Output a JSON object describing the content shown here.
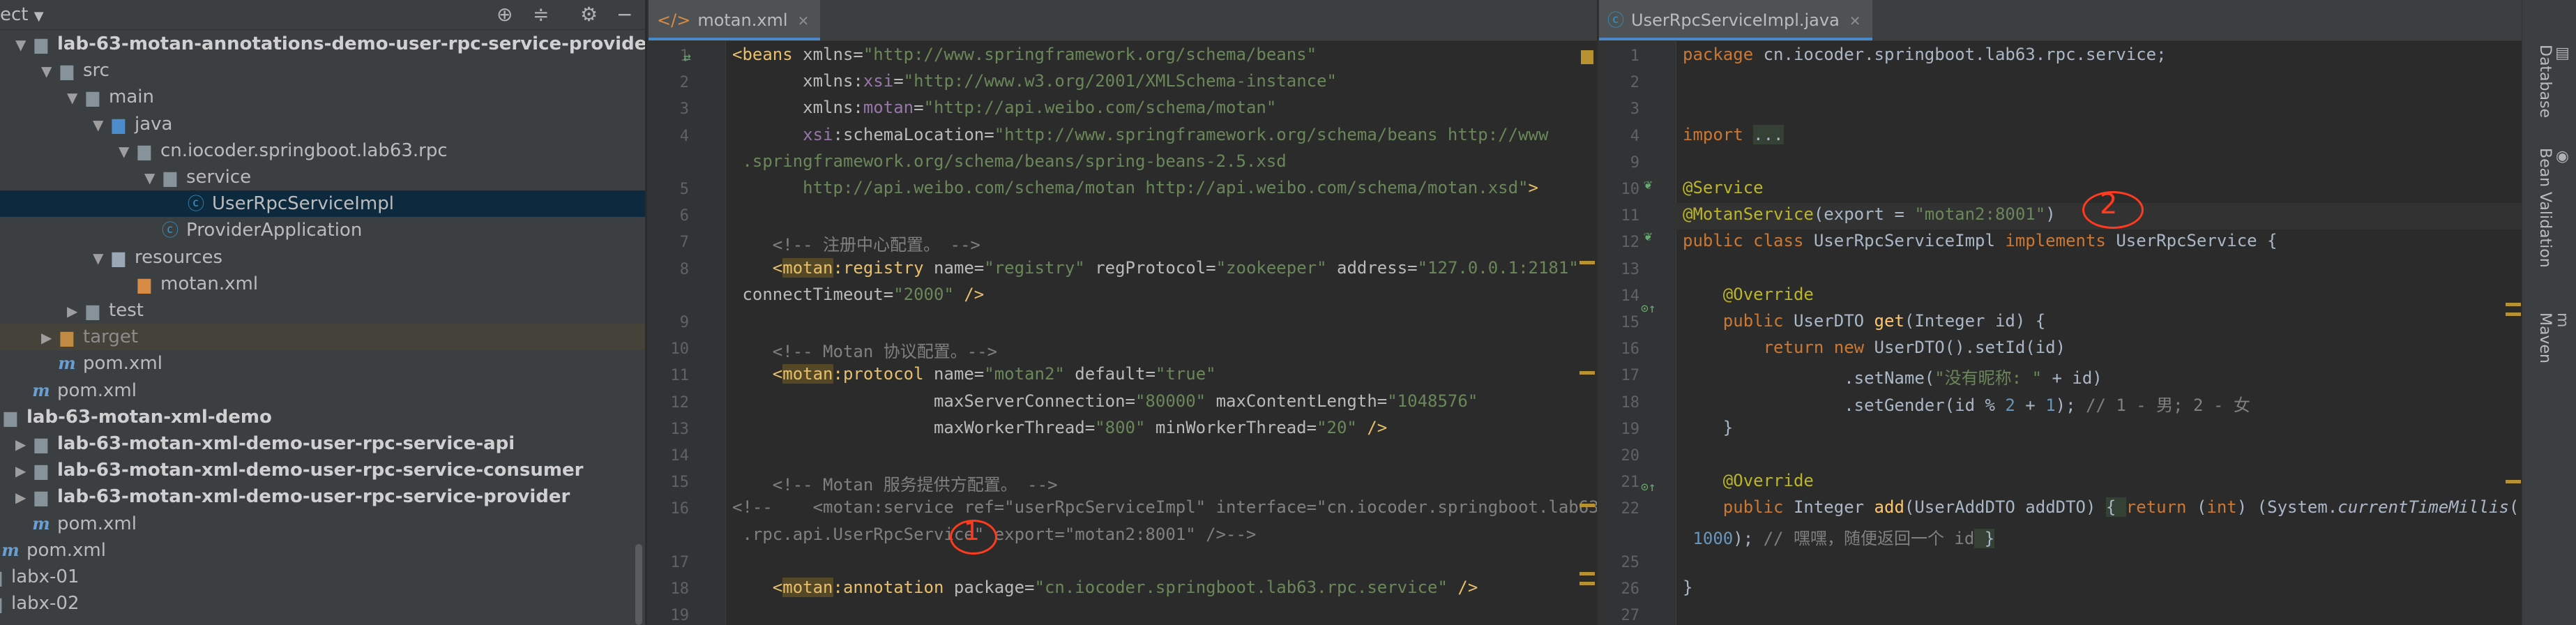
{
  "project_tree": {
    "toolbar": {
      "title": "ect",
      "icons": [
        "target-icon",
        "collapse-icon",
        "gear-icon",
        "hide-icon"
      ]
    },
    "rows": [
      {
        "label": "pom.xml",
        "indent": 2,
        "icon": "pom",
        "arrow": ""
      },
      {
        "label": "lab-63-motan-annotations-demo-user-rpc-service-provider",
        "indent": 0,
        "icon": "module",
        "arrow": "down",
        "bold": true
      },
      {
        "label": "src",
        "indent": 1,
        "icon": "folder",
        "arrow": "down"
      },
      {
        "label": "main",
        "indent": 2,
        "icon": "folder",
        "arrow": "down"
      },
      {
        "label": "java",
        "indent": 3,
        "icon": "folder-src",
        "arrow": "down"
      },
      {
        "label": "cn.iocoder.springboot.lab63.rpc",
        "indent": 4,
        "icon": "package",
        "arrow": "down"
      },
      {
        "label": "service",
        "indent": 5,
        "icon": "package",
        "arrow": "down"
      },
      {
        "label": "UserRpcServiceImpl",
        "indent": 6,
        "icon": "class",
        "arrow": "",
        "selected": true
      },
      {
        "label": "ProviderApplication",
        "indent": 5,
        "icon": "class-run",
        "arrow": ""
      },
      {
        "label": "resources",
        "indent": 3,
        "icon": "folder-res",
        "arrow": "down"
      },
      {
        "label": "motan.xml",
        "indent": 4,
        "icon": "xml",
        "arrow": ""
      },
      {
        "label": "test",
        "indent": 2,
        "icon": "folder",
        "arrow": "right"
      },
      {
        "label": "target",
        "indent": 1,
        "icon": "folder-target",
        "arrow": "right",
        "dim": true
      },
      {
        "label": "pom.xml",
        "indent": 1,
        "icon": "pom",
        "arrow": ""
      },
      {
        "label": "pom.xml",
        "indent": 0,
        "icon": "pom",
        "arrow": ""
      },
      {
        "label": "lab-63-motan-xml-demo",
        "indent": -1,
        "icon": "module",
        "arrow": "",
        "bold": true
      },
      {
        "label": "lab-63-motan-xml-demo-user-rpc-service-api",
        "indent": 0,
        "icon": "module",
        "arrow": "right",
        "bold": true
      },
      {
        "label": "lab-63-motan-xml-demo-user-rpc-service-consumer",
        "indent": 0,
        "icon": "module",
        "arrow": "right",
        "bold": true
      },
      {
        "label": "lab-63-motan-xml-demo-user-rpc-service-provider",
        "indent": 0,
        "icon": "module",
        "arrow": "right",
        "bold": true
      },
      {
        "label": "pom.xml",
        "indent": 0,
        "icon": "pom",
        "arrow": ""
      },
      {
        "label": "pom.xml",
        "indent": -1,
        "icon": "pom",
        "arrow": ""
      },
      {
        "label": "labx-01",
        "indent": -2,
        "icon": "module",
        "arrow": ""
      },
      {
        "label": "labx-02",
        "indent": -2,
        "icon": "module",
        "arrow": ""
      }
    ]
  },
  "editor_left": {
    "tab_label": "motan.xml",
    "lines": [
      {
        "n": "1",
        "html": "<span class='tg'>&lt;beans</span> <span class='at'>xmlns=</span><span class='st'>\"http://www.springframework.org/schema/beans\"</span>"
      },
      {
        "n": "2",
        "html": "       <span class='at'>xmlns:</span><span class='ns'>xsi</span><span class='at'>=</span><span class='st'>\"http://www.w3.org/2001/XMLSchema-instance\"</span>"
      },
      {
        "n": "3",
        "html": "       <span class='at'>xmlns:</span><span class='ns'>motan</span><span class='at'>=</span><span class='st'>\"http://api.weibo.com/schema/motan\"</span>"
      },
      {
        "n": "4",
        "html": "       <span class='ns'>xsi</span><span class='at'>:schemaLocation=</span><span class='st'>\"http://www.springframework.org/schema/beans http://www</span>"
      },
      {
        "n": "",
        "html": " <span class='st'>.springframework.org/schema/beans/spring-beans-2.5.xsd</span>"
      },
      {
        "n": "5",
        "html": "       <span class='st'>http://api.weibo.com/schema/motan http://api.weibo.com/schema/motan.xsd\"</span><span class='tg'>&gt;</span>"
      },
      {
        "n": "6",
        "html": ""
      },
      {
        "n": "7",
        "html": "    <span class='cm'>&lt;!-- 注册中心配置。 --&gt;</span>"
      },
      {
        "n": "8",
        "html": "    <span class='tg'>&lt;<span class='hlt'>motan</span>:registry</span> <span class='at'>name=</span><span class='st'>\"registry\"</span> <span class='at'>regProtocol=</span><span class='st'>\"zookeeper\"</span> <span class='at'>address=</span><span class='st'>\"127.0.0.1:2181\"</span>"
      },
      {
        "n": "",
        "html": " <span class='at'>connectTimeout=</span><span class='st'>\"2000\"</span> <span class='tg'>/&gt;</span>"
      },
      {
        "n": "9",
        "html": ""
      },
      {
        "n": "10",
        "html": "    <span class='cm'>&lt;!-- Motan 协议配置。--&gt;</span>"
      },
      {
        "n": "11",
        "html": "    <span class='tg'>&lt;<span class='hlt'>motan</span>:protocol</span> <span class='at'>name=</span><span class='st'>\"motan2\"</span> <span class='at'>default=</span><span class='st'>\"true\"</span>"
      },
      {
        "n": "12",
        "html": "                    <span class='at'>maxServerConnection=</span><span class='st'>\"80000\"</span> <span class='at'>maxContentLength=</span><span class='st'>\"1048576\"</span>"
      },
      {
        "n": "13",
        "html": "                    <span class='at'>maxWorkerThread=</span><span class='st'>\"800\"</span> <span class='at'>minWorkerThread=</span><span class='st'>\"20\"</span> <span class='tg'>/&gt;</span>"
      },
      {
        "n": "14",
        "html": ""
      },
      {
        "n": "15",
        "html": "    <span class='cm'>&lt;!-- Motan 服务提供方配置。 --&gt;</span>"
      },
      {
        "n": "16",
        "html": "<span class='cm'>&lt;!--    &lt;motan:service ref=\"userRpcServiceImpl\" interface=\"cn.iocoder.springboot.lab63</span>"
      },
      {
        "n": "",
        "html": " <span class='cm'>.rpc.api.UserRpcService\" export=\"motan2:8001\" /&gt;--&gt;</span>"
      },
      {
        "n": "17",
        "html": ""
      },
      {
        "n": "18",
        "html": "    <span class='tg'>&lt;<span class='hlt'>motan</span>:annotation</span> <span class='at'>package=</span><span class='st'>\"cn.iocoder.springboot.lab63.rpc.service\"</span> <span class='tg'>/&gt;</span>"
      },
      {
        "n": "19",
        "html": ""
      },
      {
        "n": "20",
        "html": "<span class='tg'>&lt;/beans&gt;</span>"
      }
    ]
  },
  "editor_right": {
    "tab_label": "UserRpcServiceImpl.java",
    "lines": [
      {
        "n": "1",
        "html": "<span class='kw'>package</span> cn.iocoder.springboot.lab63.rpc.service;"
      },
      {
        "n": "2",
        "html": ""
      },
      {
        "n": "3",
        "html": ""
      },
      {
        "n": "4",
        "html": "<span class='kw'>import</span> <span class='hli'>...</span>"
      },
      {
        "n": "9",
        "html": ""
      },
      {
        "n": "10",
        "html": "<span class='an'>@Service</span>"
      },
      {
        "n": "11",
        "html": "<span class='an'>@MotanService</span>(export = <span class='st'>\"motan2:8001\"</span>)"
      },
      {
        "n": "12",
        "html": "<span class='kw'>public class</span> UserRpcServiceImpl <span class='kw'>implements</span> UserRpcService {"
      },
      {
        "n": "13",
        "html": ""
      },
      {
        "n": "14",
        "html": "    <span class='an'>@Override</span>"
      },
      {
        "n": "15",
        "html": "    <span class='kw'>public</span> UserDTO <span class='fn'>get</span>(Integer id) {"
      },
      {
        "n": "16",
        "html": "        <span class='kw'>return new</span> UserDTO().setId(id)"
      },
      {
        "n": "17",
        "html": "                .setName(<span class='st'>\"没有昵称: \"</span> + id)"
      },
      {
        "n": "18",
        "html": "                .setGender(id % <span class='num'>2</span> + <span class='num'>1</span>); <span class='cm'>// 1 - 男; 2 - 女</span>"
      },
      {
        "n": "19",
        "html": "    }"
      },
      {
        "n": "20",
        "html": ""
      },
      {
        "n": "21",
        "html": "    <span class='an'>@Override</span>"
      },
      {
        "n": "22",
        "html": "    <span class='kw'>public</span> Integer <span class='fn'>add</span>(UserAddDTO addDTO) <span class='hli'>{ </span><span class='kw'>return</span> (<span class='kw'>int</span>) (System.<span class='it'>currentTimeMillis</span>() /"
      },
      {
        "n": "",
        "html": " <span class='num'>1000</span>); <span class='cm'>// 嘿嘿，随便返回一个 id</span><span class='hli'> }</span>"
      },
      {
        "n": "25",
        "html": ""
      },
      {
        "n": "26",
        "html": "}"
      },
      {
        "n": "27",
        "html": ""
      }
    ]
  },
  "annotations": {
    "one": "1",
    "two": "2"
  },
  "tool_window_tabs": [
    "Database",
    "Bean Validation",
    "Maven"
  ],
  "colors": {
    "selection": "#0d293e",
    "accent": "#4a88c7",
    "annotation": "#ff3b1f"
  }
}
